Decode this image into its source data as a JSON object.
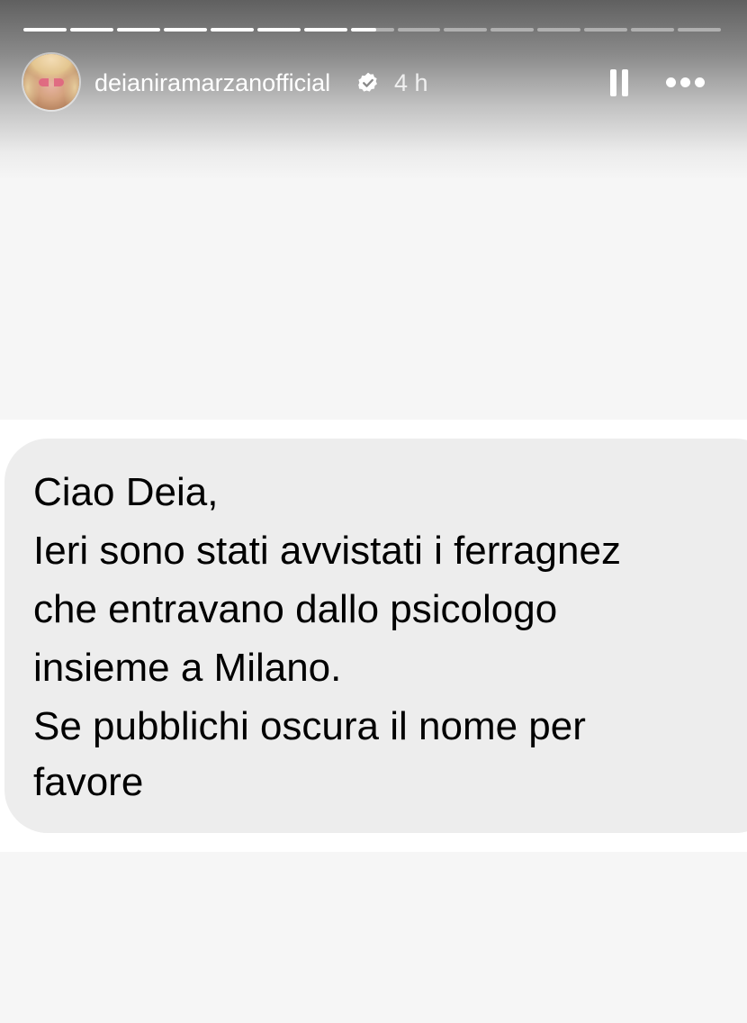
{
  "story": {
    "progress": [
      1,
      1,
      1,
      1,
      1,
      1,
      1,
      0.6,
      0,
      0,
      0,
      0,
      0,
      0,
      0
    ],
    "username": "deianiramarzanofficial",
    "timestamp": "4 h",
    "verified": true,
    "playback": "paused"
  },
  "message": {
    "lines": [
      "Ciao Deia,",
      "Ieri sono stati avvistati i ferragnez",
      "che entravano dallo psicologo",
      "insieme a Milano.",
      "Se pubblichi oscura il nome per",
      "favore"
    ]
  },
  "colors": {
    "bubble": "#ededed",
    "background": "#f6f6f6",
    "text": "#000000",
    "header_text": "#ffffff"
  },
  "icons": [
    "verified-badge-icon",
    "pause-icon",
    "more-options-icon"
  ]
}
